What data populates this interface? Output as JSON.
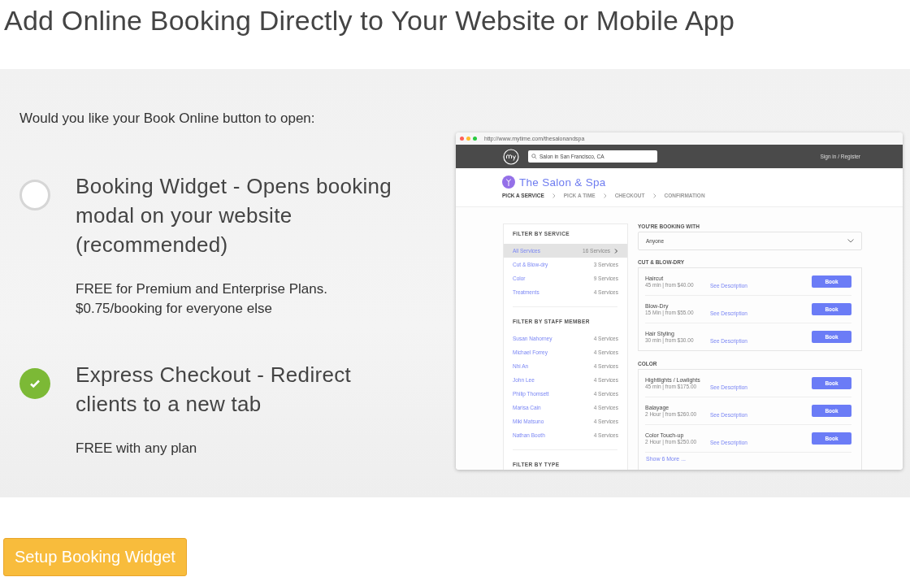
{
  "heading": "Add Online Booking Directly to Your Website or Mobile App",
  "question": "Would you like your Book Online button to open:",
  "options": [
    {
      "title": "Booking Widget - Opens booking modal on your website (recommended)",
      "selected": false,
      "note_lines": [
        "FREE for Premium and Enterprise Plans.",
        "$0.75/booking for everyone else"
      ]
    },
    {
      "title": "Express Checkout - Redirect clients to a new tab",
      "selected": true,
      "note_lines": [
        "FREE with any plan"
      ]
    }
  ],
  "preview": {
    "url": "http://www.mytime.com/thesalonandspa",
    "search_value": "Salon in San Francisco, CA",
    "sign_in": "Sign in / Register",
    "salon_name": "The Salon & Spa",
    "steps": [
      {
        "label": "PICK A SERVICE",
        "selected": true
      },
      {
        "label": "PICK A TIME",
        "selected": false
      },
      {
        "label": "CHECKOUT",
        "selected": false
      },
      {
        "label": "CONFIRMATION",
        "selected": false
      }
    ],
    "filters": [
      {
        "heading": "FILTER BY SERVICE",
        "items": [
          {
            "label": "All Services",
            "count": "16 Services",
            "selected": true
          },
          {
            "label": "Cut & Blow-dry",
            "count": "3 Services",
            "selected": false
          },
          {
            "label": "Color",
            "count": "9 Services",
            "selected": false
          },
          {
            "label": "Treatments",
            "count": "4 Services",
            "selected": false
          }
        ]
      },
      {
        "heading": "FILTER BY STAFF MEMBER",
        "items": [
          {
            "label": "Susan Nahorney",
            "count": "4 Services",
            "selected": false
          },
          {
            "label": "Michael Forrey",
            "count": "4 Services",
            "selected": false
          },
          {
            "label": "Nhi An",
            "count": "4 Services",
            "selected": false
          },
          {
            "label": "John Lee",
            "count": "4 Services",
            "selected": false
          },
          {
            "label": "Philip Thomsett",
            "count": "4 Services",
            "selected": false
          },
          {
            "label": "Marisa Cain",
            "count": "4 Services",
            "selected": false
          },
          {
            "label": "Miki Matsuno",
            "count": "4 Services",
            "selected": false
          },
          {
            "label": "Nathan Booth",
            "count": "4 Services",
            "selected": false
          }
        ]
      },
      {
        "heading": "FILTER BY TYPE"
      }
    ],
    "booking_with_label": "YOU'RE BOOKING WITH",
    "booking_with_value": "Anyone",
    "sections": [
      {
        "heading": "CUT & BLOW-DRY",
        "services": [
          {
            "name": "Haircut",
            "meta": "45 min | from $40.00",
            "link": "See Description",
            "button": "Book"
          },
          {
            "name": "Blow-Dry",
            "meta": "15 Min | from $55.00",
            "link": "See Description",
            "button": "Book"
          },
          {
            "name": "Hair Styling",
            "meta": "30 min | from $30.00",
            "link": "See Description",
            "button": "Book"
          }
        ]
      },
      {
        "heading": "COLOR",
        "services": [
          {
            "name": "Hightlights / Lowlights",
            "meta": "45 min | from $175.00",
            "link": "See Description",
            "button": "Book"
          },
          {
            "name": "Balayage",
            "meta": "2 Hour | from $260.00",
            "link": "See Description",
            "button": "Book"
          },
          {
            "name": "Color Touch-up",
            "meta": "2 Hour | from $250.00",
            "link": "See Description",
            "button": "Book"
          }
        ],
        "more": "Show 6 More ..."
      }
    ]
  },
  "setup_button": "Setup Booking Widget"
}
